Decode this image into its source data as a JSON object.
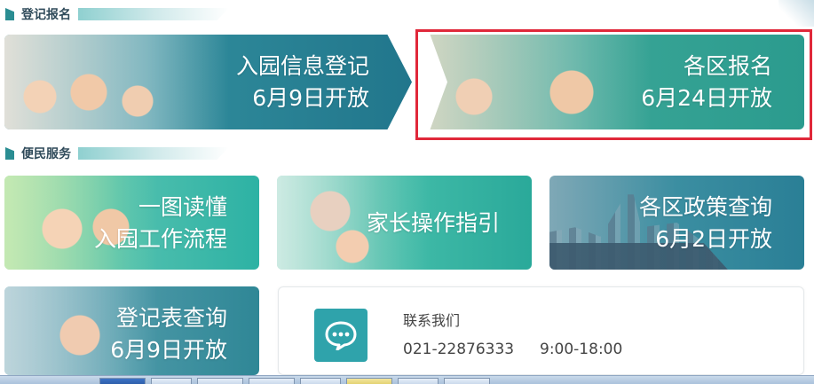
{
  "sections": {
    "registration": {
      "label": "登记报名"
    },
    "services": {
      "label": "便民服务"
    }
  },
  "cards": {
    "register": {
      "line1": "入园信息登记",
      "line2": "6月9日开放"
    },
    "district": {
      "line1": "各区报名",
      "line2": "6月24日开放"
    },
    "flow": {
      "line1": "一图读懂",
      "line2": "入园工作流程"
    },
    "guide": {
      "line1": "家长操作指引"
    },
    "policy": {
      "line1": "各区政策查询",
      "line2": "6月2日开放"
    },
    "lookup": {
      "line1": "登记表查询",
      "line2": "6月9日开放"
    }
  },
  "contact": {
    "title": "联系我们",
    "phone": "021-22876333",
    "hours": "9:00-18:00",
    "icon": "chat-bubble-icon"
  },
  "colors": {
    "accent": "#2fa3ab",
    "highlight": "#e0283a"
  }
}
